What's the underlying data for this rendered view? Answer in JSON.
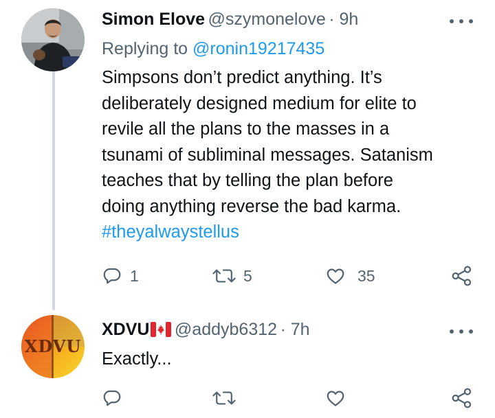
{
  "tweet1": {
    "name": "Simon Elove",
    "handle": "@szymonelove",
    "time": "· 9h",
    "replying_prefix": "Replying to",
    "replying_handle": "@ronin19217435",
    "text_lines": [
      "Simpsons don’t predict anything. It’s",
      "deliberately designed medium for elite to",
      "revile all the plans to the masses in a",
      "tsunami of subliminal messages. Satanism",
      "teaches that by telling the plan before",
      "doing anything reverse the bad karma."
    ],
    "hashtag": "#theyalwaystellus",
    "replies": "1",
    "retweets": "5",
    "likes": "35"
  },
  "tweet2": {
    "name": "XDVU",
    "flag_icon": "canada-flag-icon",
    "handle": "@addyb6312",
    "time": "· 7h",
    "text": "Exactly...",
    "avatar_text": "XDVU"
  },
  "icons": [
    "reply-icon",
    "retweet-icon",
    "like-icon",
    "share-icon",
    "more-icon"
  ],
  "colors": {
    "link": "#1d9bf0",
    "muted": "#536471",
    "thread_line": "#cfd9de"
  }
}
